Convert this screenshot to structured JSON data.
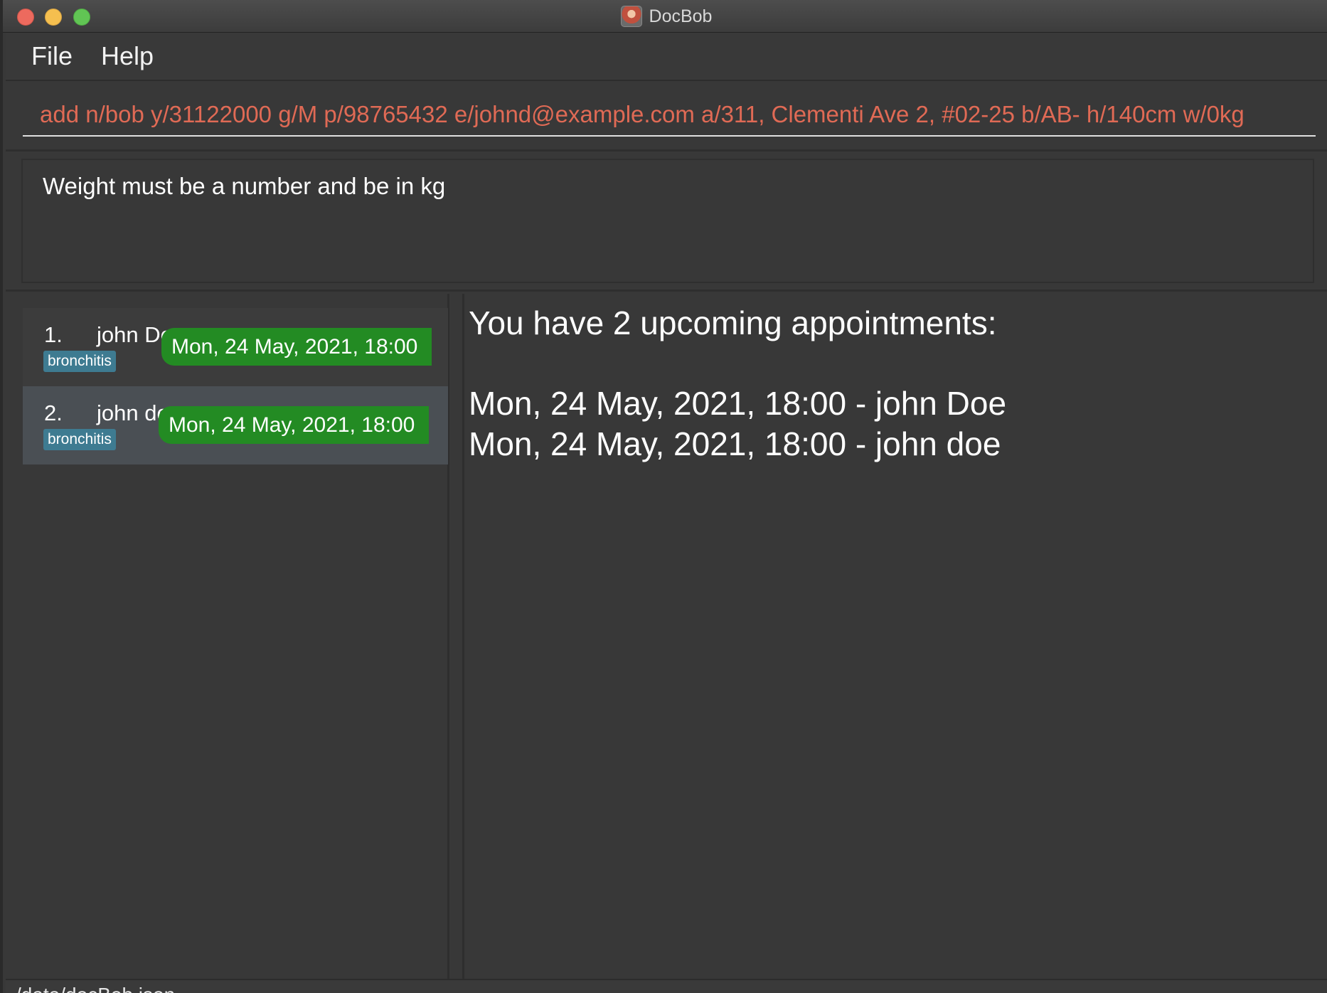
{
  "window": {
    "title": "DocBob",
    "icon": "docbob-app-icon"
  },
  "menu": {
    "items": [
      {
        "label": "File"
      },
      {
        "label": "Help"
      }
    ]
  },
  "command": {
    "value": "add n/bob y/31122000 g/M p/98765432 e/johnd@example.com a/311, Clementi Ave 2, #02-25 b/AB- h/140cm w/0kg",
    "text_color": "#e06a55"
  },
  "result": {
    "message": "Weight must be a number and be in kg"
  },
  "patients": [
    {
      "index": "1.",
      "name": "john Doe",
      "tag": "bronchitis",
      "appointment": "Mon, 24 May, 2021, 18:00"
    },
    {
      "index": "2.",
      "name": "john doe",
      "tag": "bronchitis",
      "appointment": "Mon, 24 May, 2021, 18:00"
    }
  ],
  "appointments": {
    "heading": "You have 2 upcoming appointments:",
    "lines": [
      "Mon, 24 May, 2021, 18:00 - john Doe",
      "Mon, 24 May, 2021, 18:00 - john doe"
    ]
  },
  "status": {
    "path": "/data/docBob.json"
  },
  "colors": {
    "background": "#383838",
    "appointment_badge": "#238b23",
    "tag_badge": "#3e7b91"
  }
}
